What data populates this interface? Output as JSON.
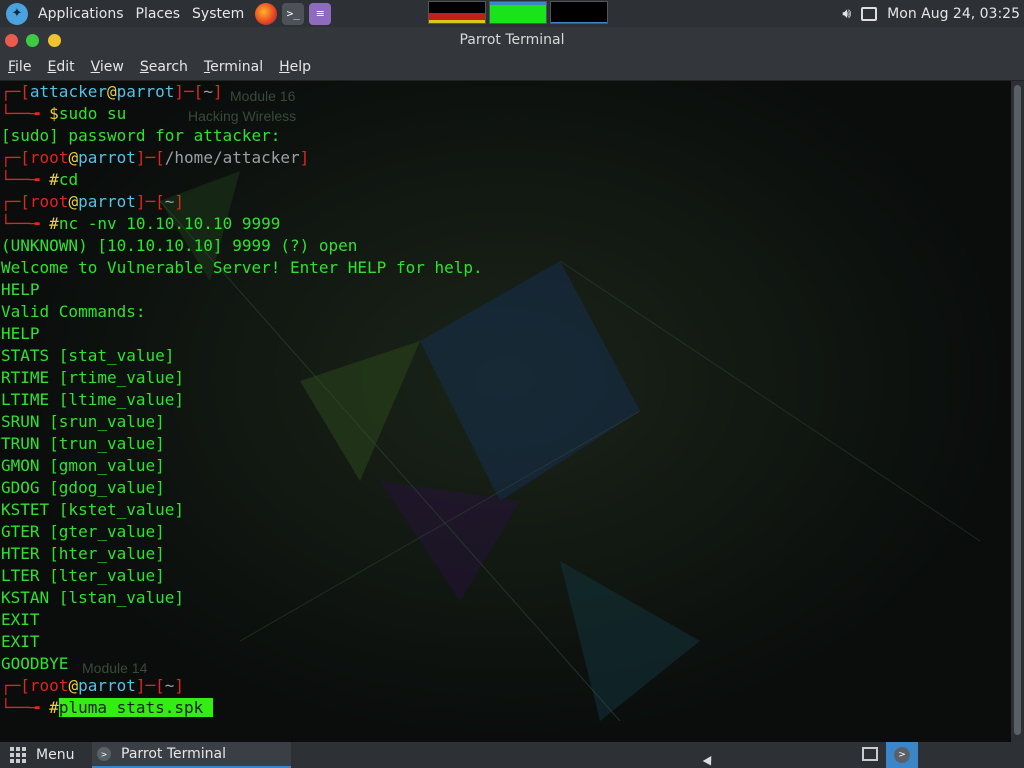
{
  "top_panel": {
    "applications": "Applications",
    "places": "Places",
    "system": "System",
    "clock": "Mon Aug 24, 03:25",
    "icons": [
      "parrot-logo-icon",
      "firefox-icon",
      "terminal-icon",
      "text-editor-icon",
      "volume-icon",
      "display-icon"
    ]
  },
  "window": {
    "title": "Parrot Terminal"
  },
  "menubar": {
    "file": {
      "u": "F",
      "rest": "ile"
    },
    "edit": {
      "u": "E",
      "rest": "dit"
    },
    "view": {
      "u": "V",
      "rest": "iew"
    },
    "search": {
      "u": "S",
      "rest": "earch"
    },
    "terminal": {
      "u": "T",
      "rest": "erminal"
    },
    "help": {
      "u": "H",
      "rest": "elp"
    }
  },
  "terminal": {
    "prompt_box_top": "┌─[",
    "prompt_box_bottom": "└──╼ ",
    "at": "@",
    "sep": "]─[",
    "close": "]",
    "p1_user": "attacker",
    "p1_host": "parrot",
    "p1_dir": "~",
    "p1_symbol": "$",
    "p1_cmd": "sudo su",
    "sudo_prompt": "[sudo] password for attacker:",
    "p2_user": "root",
    "p2_host": "parrot",
    "p2_dir": "/home/attacker",
    "p2_symbol": "#",
    "p2_cmd": "cd",
    "p3_user": "root",
    "p3_host": "parrot",
    "p3_dir": "~",
    "p3_symbol": "#",
    "p3_cmd": "nc -nv 10.10.10.10 9999",
    "output": [
      "(UNKNOWN) [10.10.10.10] 9999 (?) open",
      "Welcome to Vulnerable Server! Enter HELP for help.",
      "HELP",
      "Valid Commands:",
      "HELP",
      "STATS [stat_value]",
      "RTIME [rtime_value]",
      "LTIME [ltime_value]",
      "SRUN [srun_value]",
      "TRUN [trun_value]",
      "GMON [gmon_value]",
      "GDOG [gdog_value]",
      "KSTET [kstet_value]",
      "GTER [gter_value]",
      "HTER [hter_value]",
      "LTER [lter_value]",
      "KSTAN [lstan_value]",
      "EXIT",
      "EXIT",
      "GOODBYE"
    ],
    "p4_user": "root",
    "p4_host": "parrot",
    "p4_dir": "~",
    "p4_symbol": "#",
    "p4_cmd": "pluma stats.spk ",
    "bg_text": [
      "Module 16",
      "Hacking Wireless",
      "Module 14"
    ]
  },
  "bottom_panel": {
    "menu": "Menu",
    "task_label": "Parrot Terminal"
  },
  "colors": {
    "prompt_frame": "#e0261f",
    "user_host": "#55c1e6",
    "at_sign": "#e8d23a",
    "output_text": "#2fe22f",
    "selection": "#33ee11"
  }
}
